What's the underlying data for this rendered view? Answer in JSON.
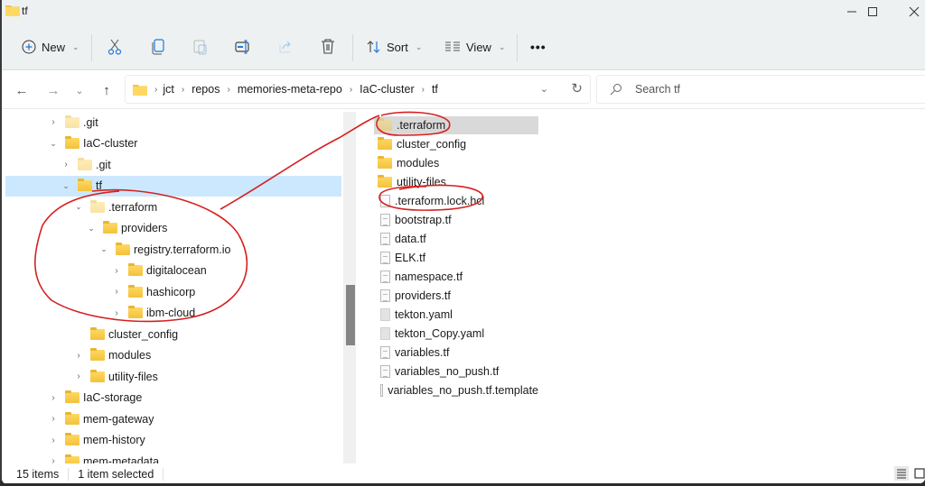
{
  "window": {
    "title": "tf",
    "controls": {
      "minimize": "–",
      "maximize": "□",
      "close": "✕"
    }
  },
  "toolbar": {
    "new_label": "New",
    "sort_label": "Sort",
    "view_label": "View",
    "more_label": "•••",
    "icons": [
      "plus-circle-icon",
      "cut-icon",
      "copy-icon",
      "paste-icon",
      "rename-icon",
      "share-icon",
      "delete-icon",
      "sort-icon",
      "view-icon",
      "more-icon"
    ]
  },
  "nav": {
    "back": "←",
    "forward": "→",
    "recent": "⌄",
    "up": "↑",
    "breadcrumb": [
      "jct",
      "repos",
      "memories-meta-repo",
      "IaC-cluster",
      "tf"
    ],
    "search_placeholder": "Search tf"
  },
  "tree": [
    {
      "label": ".git",
      "level": 1,
      "state": "collapsed",
      "hidden": true
    },
    {
      "label": "IaC-cluster",
      "level": 1,
      "state": "expanded",
      "hidden": false
    },
    {
      "label": ".git",
      "level": 2,
      "state": "collapsed",
      "hidden": true
    },
    {
      "label": "tf",
      "level": 2,
      "state": "expanded",
      "hidden": false,
      "selected": true
    },
    {
      "label": ".terraform",
      "level": 3,
      "state": "expanded",
      "hidden": true
    },
    {
      "label": "providers",
      "level": 4,
      "state": "expanded",
      "hidden": false
    },
    {
      "label": "registry.terraform.io",
      "level": 5,
      "state": "expanded",
      "hidden": false
    },
    {
      "label": "digitalocean",
      "level": 6,
      "state": "collapsed",
      "hidden": false
    },
    {
      "label": "hashicorp",
      "level": 6,
      "state": "collapsed",
      "hidden": false
    },
    {
      "label": "ibm-cloud",
      "level": 6,
      "state": "collapsed",
      "hidden": false
    },
    {
      "label": "cluster_config",
      "level": 3,
      "state": "none",
      "hidden": false
    },
    {
      "label": "modules",
      "level": 3,
      "state": "collapsed",
      "hidden": false
    },
    {
      "label": "utility-files",
      "level": 3,
      "state": "collapsed",
      "hidden": false
    },
    {
      "label": "IaC-storage",
      "level": 1,
      "state": "collapsed",
      "hidden": false
    },
    {
      "label": "mem-gateway",
      "level": 1,
      "state": "collapsed",
      "hidden": false
    },
    {
      "label": "mem-history",
      "level": 1,
      "state": "collapsed",
      "hidden": false
    },
    {
      "label": "mem-metadata",
      "level": 1,
      "state": "collapsed",
      "hidden": false
    }
  ],
  "files": [
    {
      "name": ".terraform",
      "type": "folder",
      "selected": true,
      "hidden": true
    },
    {
      "name": "cluster_config",
      "type": "folder"
    },
    {
      "name": "modules",
      "type": "folder"
    },
    {
      "name": "utility-files",
      "type": "folder"
    },
    {
      "name": ".terraform.lock.hcl",
      "type": "file-blank"
    },
    {
      "name": "bootstrap.tf",
      "type": "file-text"
    },
    {
      "name": "data.tf",
      "type": "file-text"
    },
    {
      "name": "ELK.tf",
      "type": "file-text"
    },
    {
      "name": "namespace.tf",
      "type": "file-text"
    },
    {
      "name": "providers.tf",
      "type": "file-text"
    },
    {
      "name": "tekton.yaml",
      "type": "file-solid"
    },
    {
      "name": "tekton_Copy.yaml",
      "type": "file-solid"
    },
    {
      "name": "variables.tf",
      "type": "file-text"
    },
    {
      "name": "variables_no_push.tf",
      "type": "file-text"
    },
    {
      "name": "variables_no_push.tf.template",
      "type": "file-blank"
    }
  ],
  "status": {
    "item_count": "15 items",
    "selection": "1 item selected"
  },
  "annotation_color": "#d62020",
  "selection_color": "#cce8ff"
}
